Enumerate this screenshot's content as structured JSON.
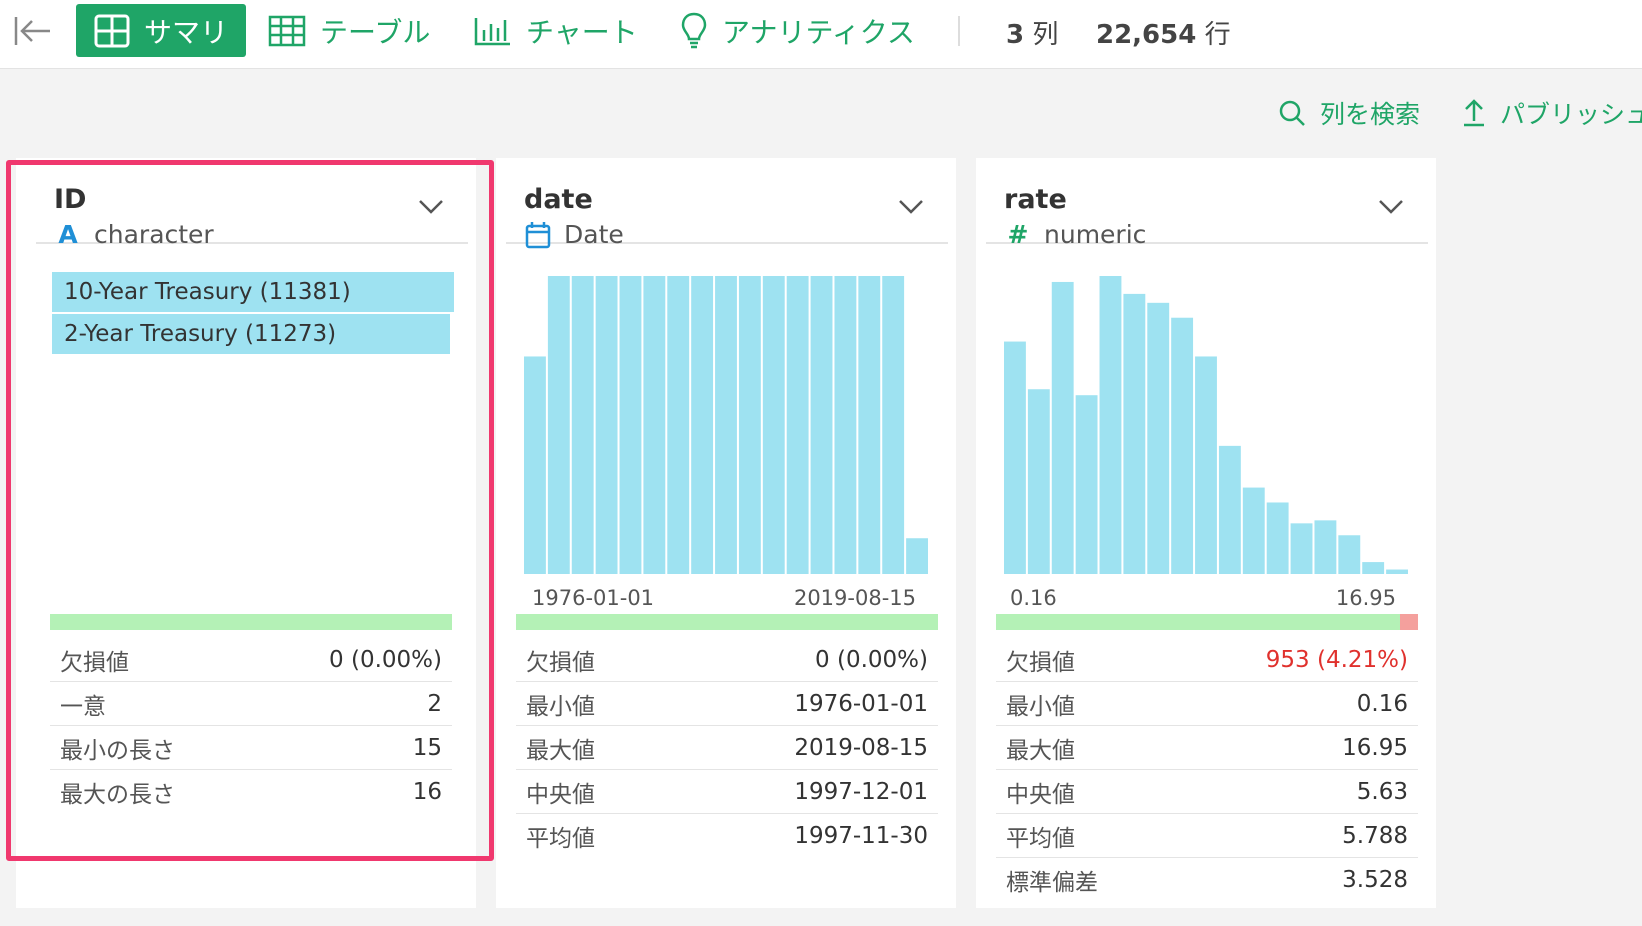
{
  "toolbar": {
    "tabs": [
      {
        "label": "サマリ",
        "icon": "grid-icon",
        "active": true
      },
      {
        "label": "テーブル",
        "icon": "table-icon",
        "active": false
      },
      {
        "label": "チャート",
        "icon": "bar-chart-icon",
        "active": false
      },
      {
        "label": "アナリティクス",
        "icon": "lightbulb-icon",
        "active": false
      }
    ],
    "columns_count": "3",
    "columns_unit": "列",
    "rows_count": "22,654",
    "rows_unit": "行"
  },
  "actions": {
    "search_columns": "列を検索",
    "publish": "パブリッシュ"
  },
  "colors": {
    "accent": "#1fa567",
    "bar": "#9ee2f1",
    "complete": "#b4f1b6",
    "missing": "#f4a09d",
    "highlight": "#f0386e",
    "missing_text": "#e0312d"
  },
  "columns": [
    {
      "name": "ID",
      "type_icon": "A",
      "type": "character",
      "top_values": [
        {
          "label": "10-Year Treasury (11381)",
          "count": 11381
        },
        {
          "label": "2-Year Treasury (11273)",
          "count": 11273
        }
      ],
      "missing_fraction": 0.0,
      "stats": [
        {
          "label": "欠損値",
          "value": "0 (0.00%)"
        },
        {
          "label": "一意",
          "value": "2"
        },
        {
          "label": "最小の長さ",
          "value": "15"
        },
        {
          "label": "最大の長さ",
          "value": "16"
        }
      ]
    },
    {
      "name": "date",
      "type_icon": "calendar-icon",
      "type": "Date",
      "axis_min": "1976-01-01",
      "axis_max": "2019-08-15",
      "missing_fraction": 0.0,
      "stats": [
        {
          "label": "欠損値",
          "value": "0 (0.00%)"
        },
        {
          "label": "最小値",
          "value": "1976-01-01"
        },
        {
          "label": "最大値",
          "value": "2019-08-15"
        },
        {
          "label": "中央値",
          "value": "1997-12-01"
        },
        {
          "label": "平均値",
          "value": "1997-11-30"
        }
      ]
    },
    {
      "name": "rate",
      "type_icon": "#",
      "type": "numeric",
      "axis_min": "0.16",
      "axis_max": "16.95",
      "missing_fraction": 0.0421,
      "stats": [
        {
          "label": "欠損値",
          "value": "953 (4.21%)",
          "alert": true
        },
        {
          "label": "最小値",
          "value": "0.16"
        },
        {
          "label": "最大値",
          "value": "16.95"
        },
        {
          "label": "中央値",
          "value": "5.63"
        },
        {
          "label": "平均値",
          "value": "5.788"
        },
        {
          "label": "標準偏差",
          "value": "3.528"
        }
      ]
    }
  ],
  "chart_data": [
    {
      "type": "bar",
      "x": [
        "1976-01-01",
        "2019-08-15"
      ],
      "values": [
        73,
        100,
        100,
        100,
        100,
        100,
        100,
        100,
        100,
        100,
        100,
        100,
        100,
        100,
        100,
        100,
        12
      ]
    },
    {
      "type": "bar",
      "x": [
        "0.16",
        "16.95"
      ],
      "values": [
        78,
        62,
        98,
        60,
        100,
        94,
        91,
        86,
        73,
        43,
        29,
        24,
        17,
        18,
        13,
        4,
        1.5
      ]
    }
  ]
}
